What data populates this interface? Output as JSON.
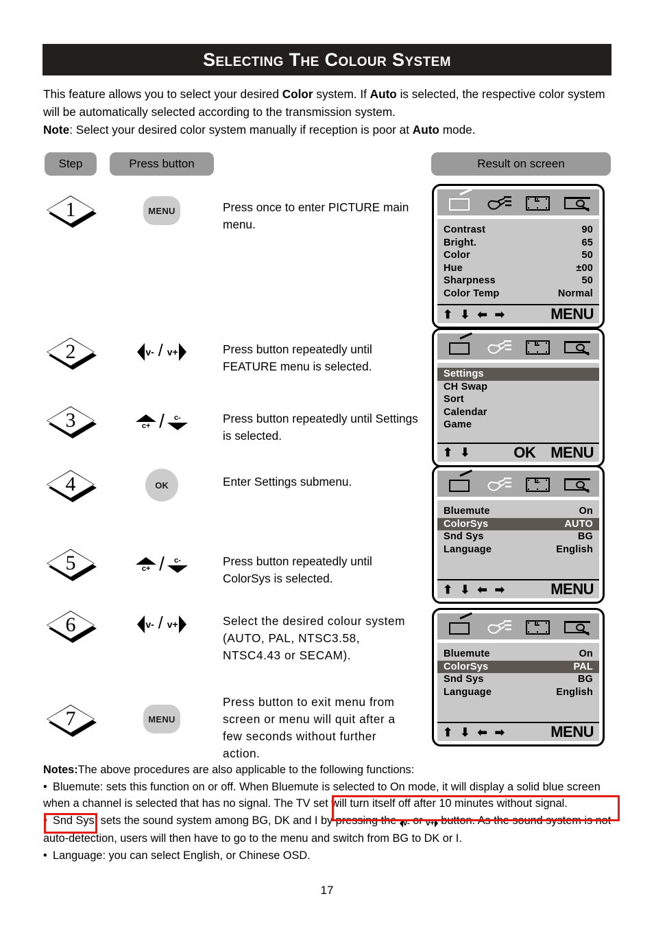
{
  "title": "Selecting the Colour System",
  "intro": {
    "line1_a": "This feature allows you to select your desired ",
    "line1_b": "Color",
    "line1_c": " system. If ",
    "line1_d": "Auto",
    "line1_e": " is selected, the respective color system will be automatically selected according to the transmission system.",
    "note_label": "Note",
    "note_a": ": Select your desired color system manually if reception is poor at ",
    "note_b": "Auto",
    "note_c": " mode."
  },
  "headers": {
    "step": "Step",
    "press_button": "Press  button",
    "result_on_screen": "Result  on  screen"
  },
  "buttons": {
    "menu": "MENU",
    "ok": "OK",
    "v_minus": "v-",
    "v_plus": "v+",
    "c_plus": "c+",
    "c_minus": "c-"
  },
  "steps": [
    {
      "num": "1",
      "button": "menu",
      "desc": "Press once to enter PICTURE main menu."
    },
    {
      "num": "2",
      "button": "volume",
      "desc": "Press button repeatedly until FEATURE menu is selected."
    },
    {
      "num": "3",
      "button": "channel",
      "desc": "Press button repeatedly until Settings is selected."
    },
    {
      "num": "4",
      "button": "ok",
      "desc": "Enter Settings submenu."
    },
    {
      "num": "5",
      "button": "channel",
      "desc": "Press button repeatedly until ColorSys is selected."
    },
    {
      "num": "6",
      "button": "volume",
      "desc": "Select the desired colour system (AUTO, PAL, NTSC3.58, NTSC4.43 or SECAM)."
    },
    {
      "num": "7",
      "button": "menu",
      "desc": "Press button to exit menu from screen or menu will quit after a few seconds without further action."
    }
  ],
  "screens": [
    {
      "id": "picture-menu",
      "active_icon": 0,
      "rows": [
        {
          "label": "Contrast",
          "value": "90",
          "highlight": false
        },
        {
          "label": "Bright.",
          "value": "65",
          "highlight": false
        },
        {
          "label": "Color",
          "value": "50",
          "highlight": false
        },
        {
          "label": "Hue",
          "value": "±00",
          "highlight": false
        },
        {
          "label": "Sharpness",
          "value": "50",
          "highlight": false
        },
        {
          "label": "Color Temp",
          "value": "Normal",
          "highlight": false
        }
      ],
      "footer": {
        "arrows": [
          "up",
          "down",
          "left",
          "right"
        ],
        "ok": "",
        "menu": "MENU"
      }
    },
    {
      "id": "feature-menu",
      "active_icon": 1,
      "rows": [
        {
          "label": "Settings",
          "value": "",
          "highlight": true
        },
        {
          "label": "CH Swap",
          "value": "",
          "highlight": false
        },
        {
          "label": "Sort",
          "value": "",
          "highlight": false
        },
        {
          "label": "Calendar",
          "value": "",
          "highlight": false
        },
        {
          "label": "Game",
          "value": "",
          "highlight": false
        }
      ],
      "footer": {
        "arrows": [
          "up",
          "down"
        ],
        "ok": "OK",
        "menu": "MENU"
      }
    },
    {
      "id": "settings-submenu-auto",
      "active_icon": 1,
      "rows": [
        {
          "label": "Bluemute",
          "value": "On",
          "highlight": false
        },
        {
          "label": "ColorSys",
          "value": "AUTO",
          "highlight": true
        },
        {
          "label": "Snd Sys",
          "value": "BG",
          "highlight": false
        },
        {
          "label": "Language",
          "value": "English",
          "highlight": false
        }
      ],
      "footer": {
        "arrows": [
          "up",
          "down",
          "left",
          "right"
        ],
        "ok": "",
        "menu": "MENU"
      }
    },
    {
      "id": "settings-submenu-pal",
      "active_icon": 1,
      "rows": [
        {
          "label": "Bluemute",
          "value": "On",
          "highlight": false
        },
        {
          "label": "ColorSys",
          "value": "PAL",
          "highlight": true
        },
        {
          "label": "Snd Sys",
          "value": "BG",
          "highlight": false
        },
        {
          "label": "Language",
          "value": "English",
          "highlight": false
        }
      ],
      "footer": {
        "arrows": [
          "up",
          "down",
          "left",
          "right"
        ],
        "ok": "",
        "menu": "MENU"
      }
    }
  ],
  "notes": {
    "label": "Notes:",
    "lead": "The above procedures are also applicable to  the following functions:",
    "bullet1_a": "Bluemute: sets this function on or off. When Bluemute is selected to On mode, it will display a solid blue screen when a channel is selected that has no signal.",
    "bullet1_b": "The TV set will turn itself off after 10 minutes without signal.",
    "bullet2_a": "Snd Sys: sets the sound system among BG, DK and I by pressing the ",
    "bullet2_v1": "v-",
    "bullet2_mid": " or ",
    "bullet2_v2": "v+",
    "bullet2_b": " button.  As the sound system is not auto-detection, users will then have to go to the menu and switch from BG to DK or I.",
    "bullet3": "Language: you can select English, or Chinese OSD."
  },
  "page_number": "17",
  "colors": {
    "banner_bg": "#231f1c",
    "pill_bg": "#9a9a9a",
    "osd_iconbar": "#a9a9a9",
    "osd_body": "#c8c8c8",
    "osd_highlight": "#5d5751",
    "button_gray": "#cccccc",
    "annotation_red": "#e21b13"
  }
}
